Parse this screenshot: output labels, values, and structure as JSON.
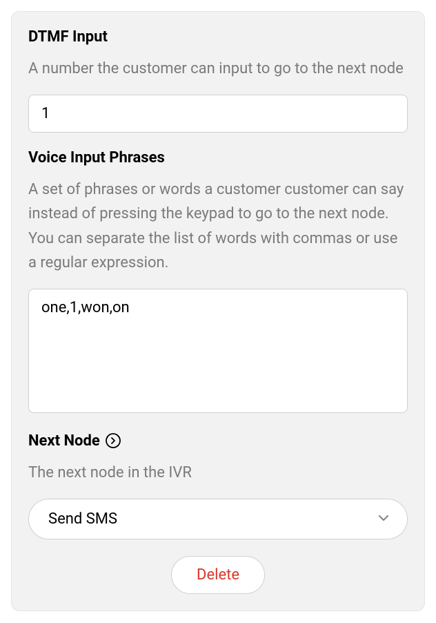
{
  "dtmf": {
    "label": "DTMF Input",
    "description": "A number the customer can input to go to the next node",
    "value": "1"
  },
  "voice": {
    "label": "Voice Input Phrases",
    "description": "A set of phrases or words a customer customer can say instead of pressing the keypad to go to the next node. You can separate the list of words with commas or use a regular expression.",
    "value": "one,1,won,on"
  },
  "nextNode": {
    "label": "Next Node",
    "description": "The next node in the IVR",
    "selected": "Send SMS"
  },
  "actions": {
    "delete": "Delete"
  }
}
